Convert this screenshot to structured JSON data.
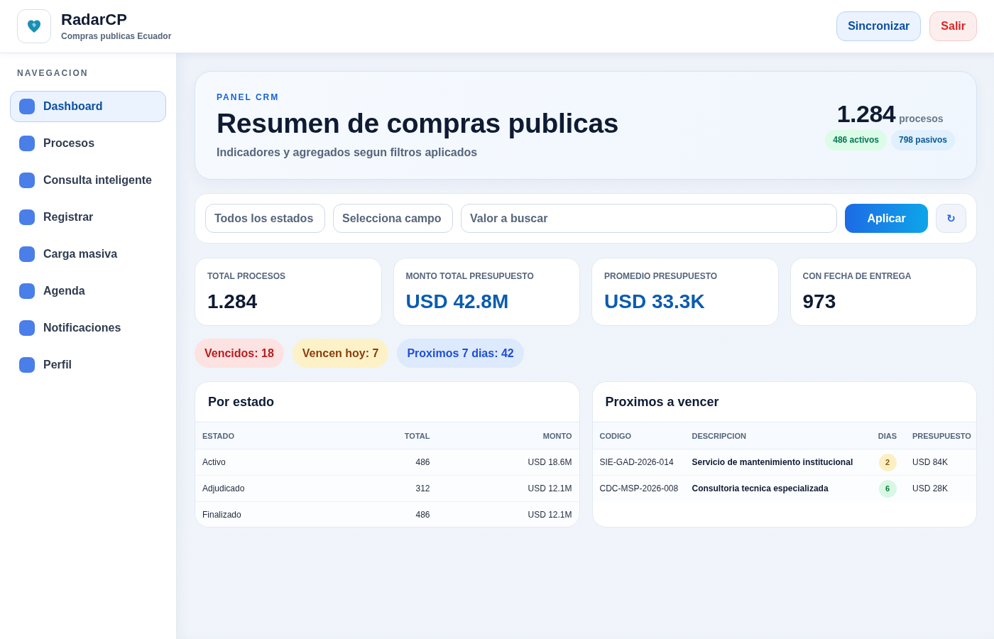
{
  "header": {
    "app_name": "RadarCP",
    "subtitle": "Compras publicas Ecuador",
    "buttons": [
      {
        "label": "Sincronizar",
        "kind": "primary"
      },
      {
        "label": "Salir",
        "kind": "danger"
      }
    ]
  },
  "sidebar": {
    "heading": "NAVEGACION",
    "items": [
      {
        "label": "Dashboard",
        "selected": true
      },
      {
        "label": "Procesos",
        "selected": false
      },
      {
        "label": "Consulta inteligente",
        "selected": false
      },
      {
        "label": "Registrar",
        "selected": false
      },
      {
        "label": "Carga masiva",
        "selected": false
      },
      {
        "label": "Agenda",
        "selected": false
      },
      {
        "label": "Notificaciones",
        "selected": false
      },
      {
        "label": "Perfil",
        "selected": false
      }
    ]
  },
  "hero": {
    "eyebrow": "PANEL CRM",
    "title": "Resumen de compras publicas",
    "subtitle": "Indicadores y agregados segun filtros aplicados",
    "total": "1.284",
    "total_unit": "procesos",
    "pills": [
      {
        "label": "486 activos",
        "kind": "success"
      },
      {
        "label": "798 pasivos",
        "kind": "info"
      }
    ]
  },
  "filters": {
    "fields": [
      {
        "kind": "select",
        "value": "Todos los estados"
      },
      {
        "kind": "select",
        "value": "Selecciona campo"
      },
      {
        "kind": "text",
        "placeholder": "Valor a buscar"
      }
    ],
    "apply_button": "Aplicar",
    "reset_button": "↻"
  },
  "stats": [
    {
      "label": "TOTAL PROCESOS",
      "value": "1.284",
      "kind": "count"
    },
    {
      "label": "MONTO TOTAL PRESUPUESTO",
      "value": "USD 42.8M",
      "kind": "money"
    },
    {
      "label": "PROMEDIO PRESUPUESTO",
      "value": "USD 33.3K",
      "kind": "money"
    },
    {
      "label": "CON FECHA DE ENTREGA",
      "value": "973",
      "kind": "count"
    }
  ],
  "alerts": [
    {
      "label": "Vencidos: 18",
      "kind": "danger"
    },
    {
      "label": "Vencen hoy: 7",
      "kind": "warning"
    },
    {
      "label": "Proximos 7 dias: 42",
      "kind": "info"
    }
  ],
  "status_table": {
    "title": "Por estado",
    "columns": [
      "ESTADO",
      "TOTAL",
      "MONTO"
    ],
    "rows": [
      [
        "Activo",
        "486",
        "USD 18.6M"
      ],
      [
        "Adjudicado",
        "312",
        "USD 12.1M"
      ],
      [
        "Finalizado",
        "486",
        "USD 12.1M"
      ]
    ]
  },
  "upcoming_table": {
    "title": "Proximos a vencer",
    "columns": [
      "CODIGO",
      "DESCRIPCION",
      "DIAS",
      "PRESUPUESTO"
    ],
    "rows": [
      {
        "code": "SIE-GAD-2026-014",
        "description": "Servicio de mantenimiento institucional",
        "days": "2",
        "color": "#fdefc4",
        "budget": "USD 84K"
      },
      {
        "code": "CDC-MSP-2026-008",
        "description": "Consultoria tecnica especializada",
        "days": "6",
        "color": "#d8f7e4",
        "budget": "USD 28K"
      }
    ]
  }
}
